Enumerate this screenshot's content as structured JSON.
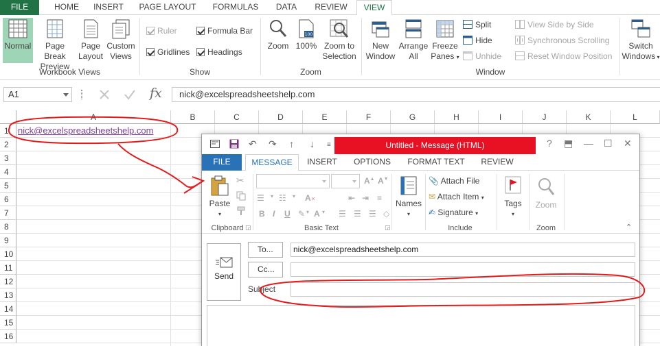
{
  "excel": {
    "tabs": [
      "FILE",
      "HOME",
      "INSERT",
      "PAGE LAYOUT",
      "FORMULAS",
      "DATA",
      "REVIEW",
      "VIEW"
    ],
    "ribbon": {
      "workbook_views": {
        "label": "Workbook Views",
        "normal": "Normal",
        "page_break_preview": [
          "Page Break",
          "Preview"
        ],
        "page_layout": [
          "Page",
          "Layout"
        ],
        "custom_views": [
          "Custom",
          "Views"
        ]
      },
      "show": {
        "label": "Show",
        "ruler": "Ruler",
        "formula_bar": "Formula Bar",
        "gridlines": "Gridlines",
        "headings": "Headings"
      },
      "zoom": {
        "label": "Zoom",
        "zoom": "Zoom",
        "hundred": "100%",
        "zoom_to_selection": [
          "Zoom to",
          "Selection"
        ]
      },
      "window": {
        "label": "Window",
        "new_window": [
          "New",
          "Window"
        ],
        "arrange_all": [
          "Arrange",
          "All"
        ],
        "freeze_panes": [
          "Freeze",
          "Panes"
        ],
        "split": "Split",
        "hide": "Hide",
        "unhide": "Unhide",
        "view_side_by_side": "View Side by Side",
        "synchronous_scrolling": "Synchronous Scrolling",
        "reset_window_position": "Reset Window Position",
        "switch_windows": [
          "Switch",
          "Windows"
        ]
      }
    },
    "name_box": "A1",
    "formula_value": "nick@excelspreadsheetshelp.com",
    "columns": [
      "A",
      "B",
      "C",
      "D",
      "E",
      "F",
      "G",
      "H",
      "I",
      "J",
      "K",
      "L"
    ],
    "rows": [
      "1",
      "2",
      "3",
      "4",
      "5",
      "6",
      "7",
      "8",
      "9",
      "10",
      "11",
      "12",
      "13",
      "14",
      "15",
      "16"
    ],
    "cell_a1": "nick@excelspreadsheetshelp.com"
  },
  "outlook": {
    "title": "Untitled -  Message (HTML)",
    "title_controls": [
      "?",
      "—",
      "☐",
      "✕"
    ],
    "tabs": [
      "FILE",
      "MESSAGE",
      "INSERT",
      "OPTIONS",
      "FORMAT TEXT",
      "REVIEW"
    ],
    "ribbon": {
      "clipboard_label": "Clipboard",
      "paste": "Paste",
      "basic_text_label": "Basic Text",
      "names": "Names",
      "include_label": "Include",
      "attach_file": "Attach File",
      "attach_item": "Attach Item",
      "signature": "Signature",
      "tags": "Tags",
      "zoom_label": "Zoom",
      "zoom": "Zoom"
    },
    "send": "Send",
    "to_button": "To...",
    "cc_button": "Cc...",
    "to_value": "nick@excelspreadsheetshelp.com",
    "cc_value": "",
    "subject_label": "Subject",
    "subject_value": ""
  }
}
